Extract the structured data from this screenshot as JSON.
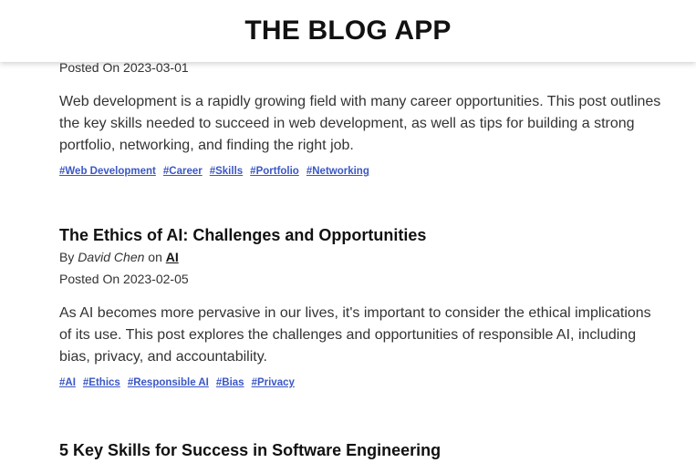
{
  "app": {
    "title": "THE BLOG APP"
  },
  "posts": [
    {
      "posted": "Posted On 2023-03-01",
      "excerpt": "Web development is a rapidly growing field with many career opportunities. This post outlines the key skills needed to succeed in web development, as well as tips for building a strong portfolio, networking, and finding the right job.",
      "tags": [
        "#Web Development",
        "#Career",
        "#Skills",
        "#Portfolio",
        "#Networking"
      ]
    },
    {
      "title": "The Ethics of AI: Challenges and Opportunities",
      "by_prefix": "By",
      "author": "David Chen",
      "on_word": "on",
      "category": "AI",
      "posted": "Posted On 2023-02-05",
      "excerpt": "As AI becomes more pervasive in our lives, it's important to consider the ethical implications of its use. This post explores the challenges and opportunities of responsible AI, including bias, privacy, and accountability.",
      "tags": [
        "#AI",
        "#Ethics",
        "#Responsible AI",
        "#Bias",
        "#Privacy"
      ]
    },
    {
      "title": "5 Key Skills for Success in Software Engineering"
    }
  ]
}
